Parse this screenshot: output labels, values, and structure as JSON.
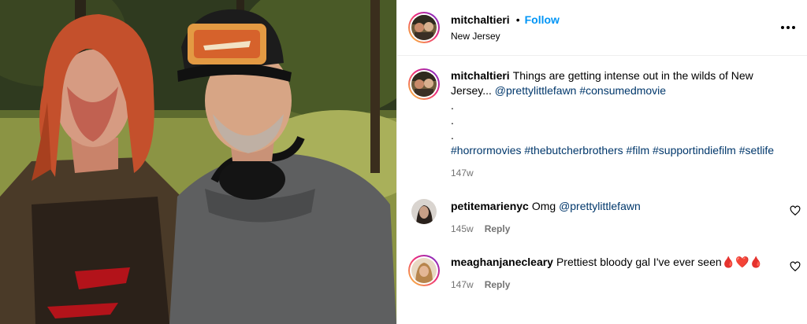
{
  "post": {
    "author": "mitchaltieri",
    "separator": "•",
    "follow_label": "Follow",
    "location": "New Jersey",
    "more_icon": "more-horizontal-icon"
  },
  "caption": {
    "author": "mitchaltieri",
    "text": "Things are getting intense out in the wilds of New Jersey... ",
    "mentions": [
      "@prettylittlefawn",
      "#consumedmovie"
    ],
    "dots": [
      ".",
      ".",
      "."
    ],
    "hashtags": "#horrormovies #thebutcherbrothers #film #supportindiefilm #setlife",
    "age": "147w"
  },
  "comments": [
    {
      "author": "petitemarienyc",
      "text": "Omg ",
      "mention": "@prettylittlefawn",
      "age": "145w",
      "reply_label": "Reply",
      "like_icon": "heart-outline-icon"
    },
    {
      "author": "meaghanjanecleary",
      "text": "Prettiest bloody gal I've ever seen",
      "emoji": "🩸❤️🩸",
      "age": "147w",
      "reply_label": "Reply",
      "like_icon": "heart-outline-icon"
    }
  ],
  "colors": {
    "link": "#00376b",
    "follow": "#0095f6",
    "meta": "#737373",
    "story_ring_start": "#f9ce34",
    "story_ring_end": "#6228d7"
  }
}
